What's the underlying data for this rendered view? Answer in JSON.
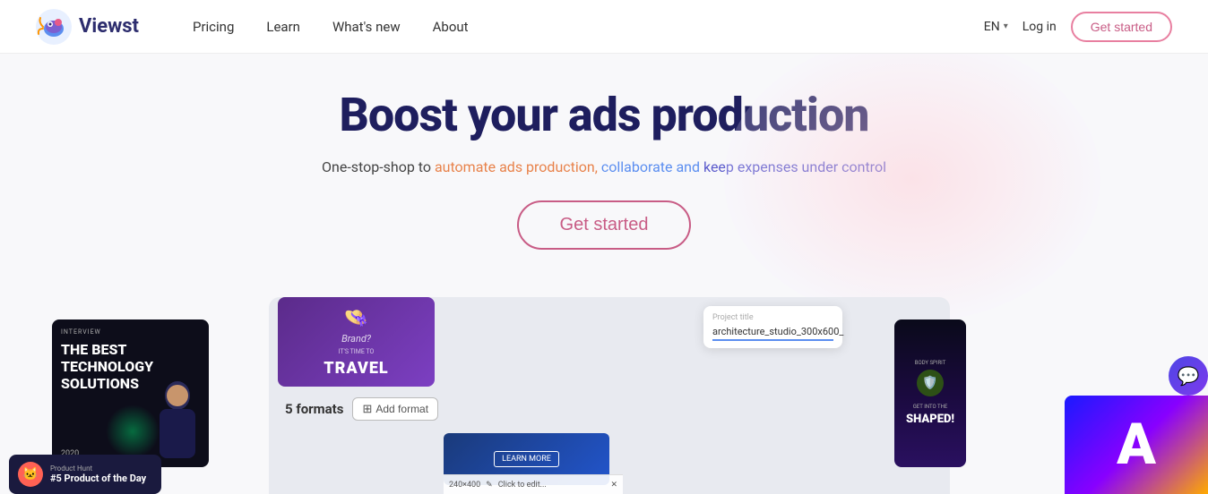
{
  "nav": {
    "logo_text": "Viewst",
    "links": [
      {
        "label": "Pricing",
        "id": "pricing"
      },
      {
        "label": "Learn",
        "id": "learn"
      },
      {
        "label": "What's new",
        "id": "whats-new"
      },
      {
        "label": "About",
        "id": "about"
      }
    ],
    "lang": "EN",
    "login": "Log in",
    "get_started": "Get started"
  },
  "hero": {
    "title": "Boost your ads production",
    "subtitle_plain": "One-stop-shop to automate ads production, collaborate and keep expenses under control",
    "cta": "Get started"
  },
  "left_card": {
    "tag": "INTERVIEW",
    "title": "THE BEST TECHNOLOGY SOLUTIONS",
    "year": "2020"
  },
  "ph_badge": {
    "label": "Product Hunt",
    "title": "#5 Product of the Day"
  },
  "formats_bar": {
    "count_label": "5 formats",
    "add_label": "Add format"
  },
  "project_card": {
    "label": "Project title",
    "value": "architecture_studio_300x600_"
  },
  "right_card": {
    "top_text": "BODY SPIRIT",
    "cta_text": "GET INTO THE",
    "main_text": "SHAPED!"
  },
  "dimension_bar": {
    "size": "240×400",
    "action": "Click to edit..."
  },
  "travel_card": {
    "brand": "Brand?",
    "subtitle": "IT'S TIME TO",
    "text": "TRAVEL"
  },
  "icons": {
    "logo": "🐠",
    "ph": "🐱",
    "chat": "💬",
    "shield": "🛡️",
    "hat": "👒"
  }
}
